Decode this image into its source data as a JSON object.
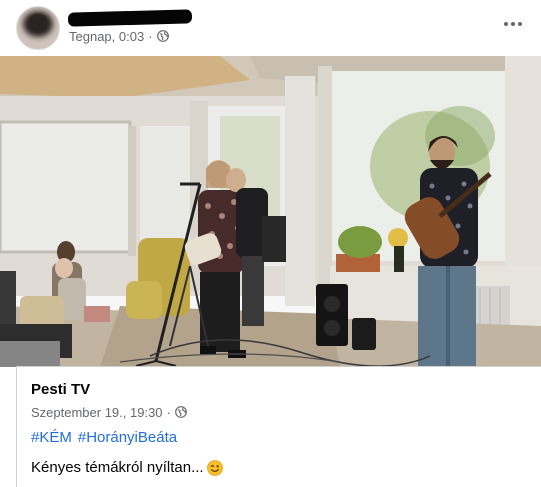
{
  "post": {
    "author_name": "",
    "timestamp": "Tegnap, 0:03",
    "separator": "·",
    "audience_icon": "globe-icon",
    "more_icon": "more-horizontal-icon"
  },
  "video": {
    "scene": "live-music-performance",
    "play_state": "paused"
  },
  "shared_post": {
    "page_name": "Pesti TV",
    "timestamp": "Szeptember 19., 19:30",
    "separator": "·",
    "audience_icon": "globe-icon",
    "hashtags": [
      "#KÉM",
      "#HorányiBeáta"
    ],
    "text": "Kényes témákról nyíltan...",
    "emoji": "winking-face-icon"
  },
  "colors": {
    "text_primary": "#050505",
    "text_secondary": "#65676b",
    "link": "#216fdb",
    "border": "#ced0d4"
  }
}
